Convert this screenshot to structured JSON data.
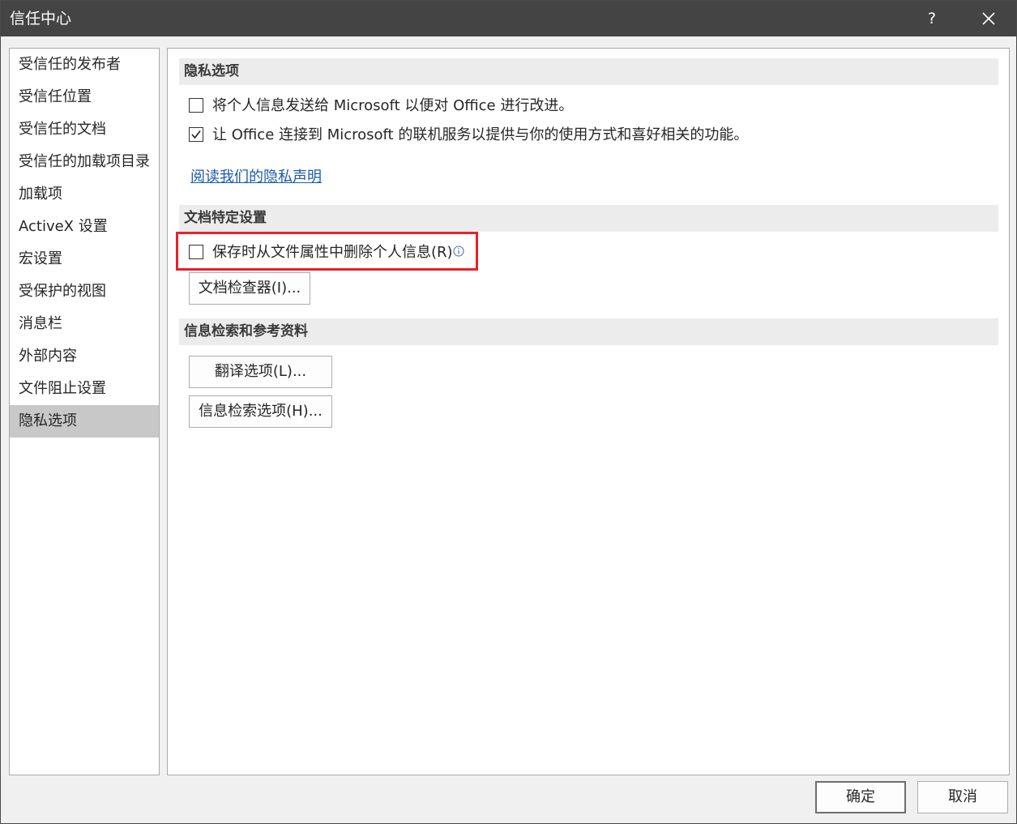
{
  "window": {
    "title": "信任中心",
    "help_label": "?",
    "close_icon": "close-icon"
  },
  "nav": {
    "items": [
      {
        "label": "受信任的发布者",
        "selected": false
      },
      {
        "label": "受信任位置",
        "selected": false
      },
      {
        "label": "受信任的文档",
        "selected": false
      },
      {
        "label": "受信任的加载项目录",
        "selected": false
      },
      {
        "label": "加载项",
        "selected": false
      },
      {
        "label": "ActiveX 设置",
        "selected": false
      },
      {
        "label": "宏设置",
        "selected": false
      },
      {
        "label": "受保护的视图",
        "selected": false
      },
      {
        "label": "消息栏",
        "selected": false
      },
      {
        "label": "外部内容",
        "selected": false
      },
      {
        "label": "文件阻止设置",
        "selected": false
      },
      {
        "label": "隐私选项",
        "selected": true
      }
    ]
  },
  "privacy": {
    "header": "隐私选项",
    "send_info_label": "将个人信息发送给 Microsoft 以便对 Office 进行改进。",
    "send_info_checked": false,
    "connected_services_label": "让 Office 连接到 Microsoft 的联机服务以提供与你的使用方式和喜好相关的功能。",
    "connected_services_checked": true,
    "privacy_statement_link": "阅读我们的隐私声明"
  },
  "document_settings": {
    "header": "文档特定设置",
    "remove_personal_info_label": "保存时从文件属性中删除个人信息(R)",
    "remove_personal_info_checked": false,
    "document_inspector_button": "文档检查器(I)..."
  },
  "research": {
    "header": "信息检索和参考资料",
    "translation_button": "翻译选项(L)...",
    "research_button": "信息检索选项(H)..."
  },
  "footer": {
    "ok_label": "确定",
    "cancel_label": "取消"
  },
  "colors": {
    "titlebar": "#444444",
    "highlight": "#e8212b",
    "link": "#1e5aa8",
    "selected_nav": "#c8c8c8"
  }
}
